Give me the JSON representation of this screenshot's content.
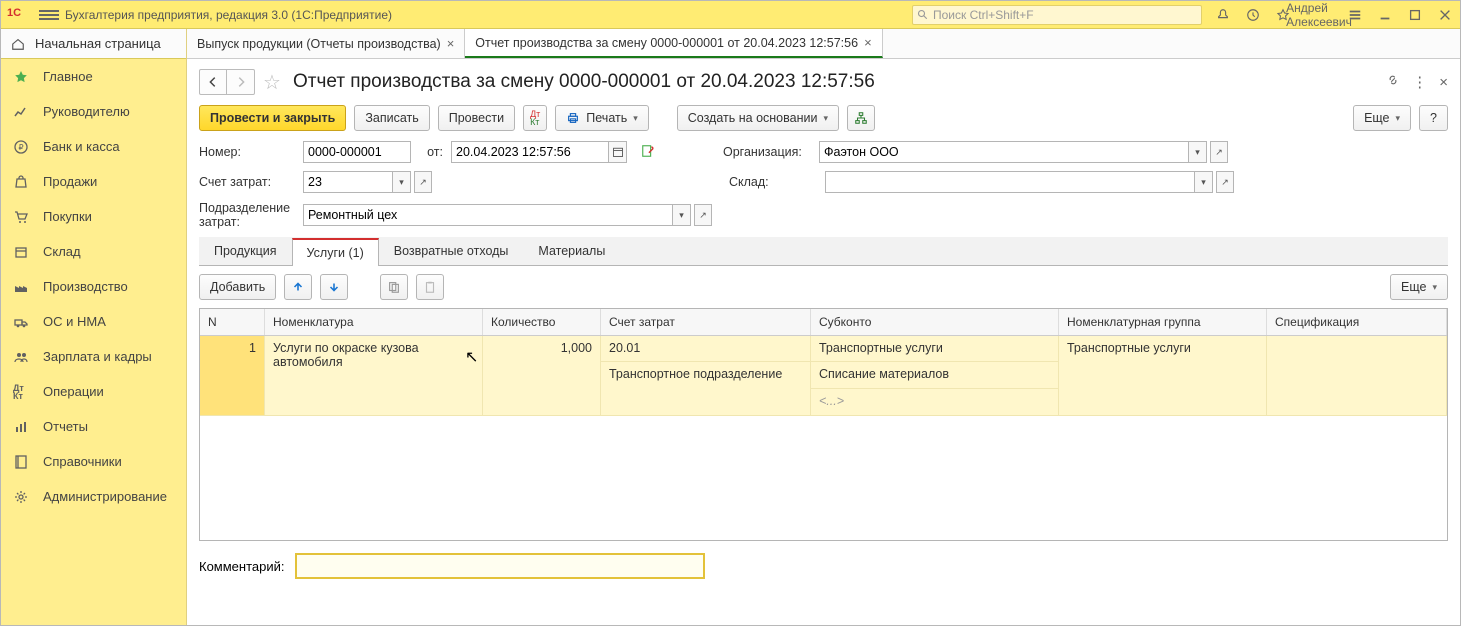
{
  "app": {
    "title": "Бухгалтерия предприятия, редакция 3.0  (1С:Предприятие)",
    "search_placeholder": "Поиск Ctrl+Shift+F",
    "user": "Андрей Алексеевич"
  },
  "sidebar": {
    "home": "Начальная страница",
    "items": [
      {
        "label": "Главное",
        "icon": "star"
      },
      {
        "label": "Руководителю",
        "icon": "chart"
      },
      {
        "label": "Банк и касса",
        "icon": "ruble"
      },
      {
        "label": "Продажи",
        "icon": "bag"
      },
      {
        "label": "Покупки",
        "icon": "cart"
      },
      {
        "label": "Склад",
        "icon": "box"
      },
      {
        "label": "Производство",
        "icon": "factory"
      },
      {
        "label": "ОС и НМА",
        "icon": "truck"
      },
      {
        "label": "Зарплата и кадры",
        "icon": "people"
      },
      {
        "label": "Операции",
        "icon": "dtkt"
      },
      {
        "label": "Отчеты",
        "icon": "bars"
      },
      {
        "label": "Справочники",
        "icon": "book"
      },
      {
        "label": "Администрирование",
        "icon": "gear"
      }
    ]
  },
  "tabs": [
    {
      "label": "Выпуск продукции (Отчеты производства)",
      "active": false
    },
    {
      "label": "Отчет производства за смену 0000-000001 от 20.04.2023 12:57:56",
      "active": true
    }
  ],
  "page": {
    "title": "Отчет производства за смену 0000-000001 от 20.04.2023 12:57:56"
  },
  "toolbar": {
    "post_close": "Провести и закрыть",
    "write": "Записать",
    "post": "Провести",
    "print": "Печать",
    "create_based": "Создать на основании",
    "more": "Еще",
    "help": "?"
  },
  "form": {
    "number_lbl": "Номер:",
    "number_val": "0000-000001",
    "date_lbl": "от:",
    "date_val": "20.04.2023 12:57:56",
    "org_lbl": "Организация:",
    "org_val": "Фаэтон ООО",
    "acc_lbl": "Счет затрат:",
    "acc_val": "23",
    "wh_lbl": "Склад:",
    "wh_val": "",
    "dept_lbl": "Подразделение затрат:",
    "dept_val": "Ремонтный цех"
  },
  "dtabs": {
    "t1": "Продукция",
    "t2": "Услуги (1)",
    "t3": "Возвратные отходы",
    "t4": "Материалы"
  },
  "tbar2": {
    "add": "Добавить",
    "more": "Еще"
  },
  "grid": {
    "headers": {
      "n": "N",
      "nom": "Номенклатура",
      "qty": "Количество",
      "acc": "Счет затрат",
      "sub": "Субконто",
      "grp": "Номенклатурная группа",
      "spec": "Спецификация"
    },
    "rows": [
      {
        "n": "1",
        "nom": "Услуги по окраске кузова автомобиля",
        "qty": "1,000",
        "acc1": "20.01",
        "acc2": "Транспортное подразделение",
        "sub1": "Транспортные услуги",
        "sub2": "Списание материалов",
        "sub3": "<...>",
        "grp": "Транспортные услуги",
        "spec": ""
      }
    ]
  },
  "comment": {
    "lbl": "Комментарий:",
    "val": ""
  }
}
